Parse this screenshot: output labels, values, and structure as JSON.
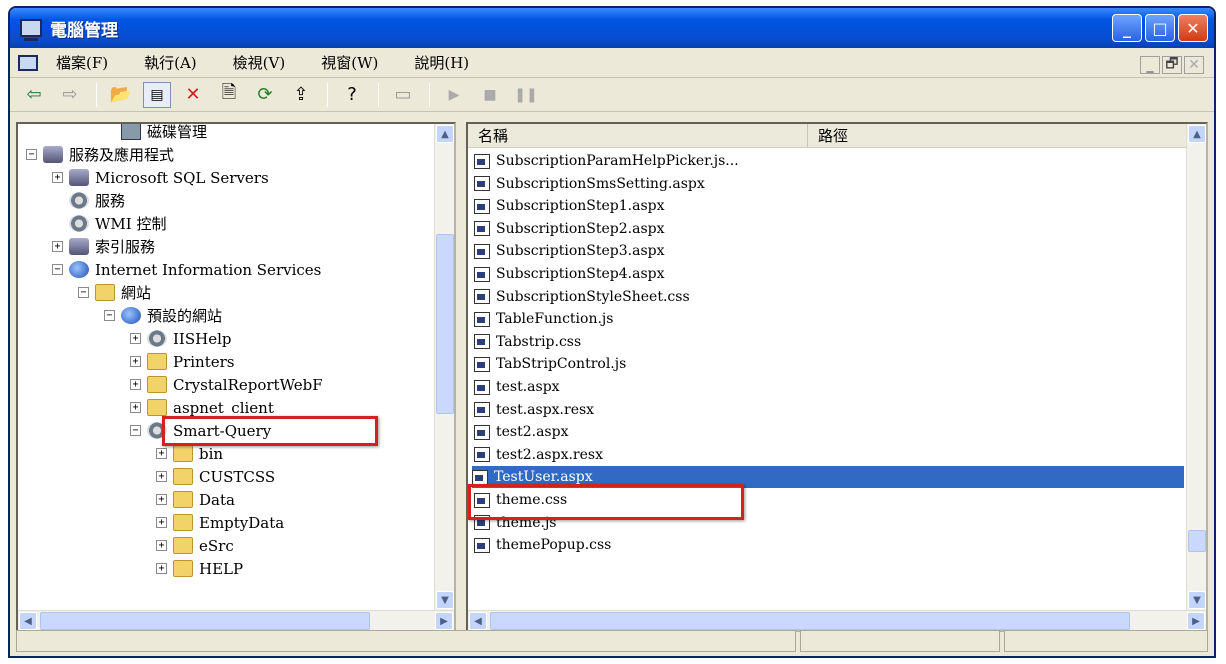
{
  "window": {
    "title": "電腦管理",
    "buttons": [
      "_",
      "□",
      "✕"
    ]
  },
  "menu": {
    "items": [
      "檔案(F)",
      "執行(A)",
      "檢視(V)",
      "視窗(W)",
      "說明(H)"
    ],
    "mdi": [
      "_",
      "🗗",
      "✕"
    ]
  },
  "toolbar": {
    "buttons": [
      "back-icon",
      "forward-icon",
      "up-folder-icon",
      "show-hide-tree-icon",
      "delete-icon",
      "properties-icon",
      "refresh-icon",
      "export-icon",
      "help-icon",
      "console-icon",
      "play-icon",
      "stop-icon",
      "pause-icon"
    ]
  },
  "tree": [
    {
      "label": "磁碟管理",
      "icon": "disk-icon",
      "indent": 3,
      "exp": ""
    },
    {
      "label": "服務及應用程式",
      "icon": "services-icon",
      "indent": 0,
      "exp": "−"
    },
    {
      "label": "Microsoft SQL Servers",
      "icon": "server-icon",
      "indent": 1,
      "exp": "+"
    },
    {
      "label": "服務",
      "icon": "gear-icon",
      "indent": 1,
      "exp": ""
    },
    {
      "label": "WMI 控制",
      "icon": "wmi-icon",
      "indent": 1,
      "exp": ""
    },
    {
      "label": "索引服務",
      "icon": "index-icon",
      "indent": 1,
      "exp": "+"
    },
    {
      "label": "Internet Information Services",
      "icon": "iis-icon",
      "indent": 1,
      "exp": "−"
    },
    {
      "label": "網站",
      "icon": "folder-icon",
      "indent": 2,
      "exp": "−"
    },
    {
      "label": "預設的網站",
      "icon": "globe-icon",
      "indent": 3,
      "exp": "−"
    },
    {
      "label": "IISHelp",
      "icon": "gear-icon",
      "indent": 4,
      "exp": "+"
    },
    {
      "label": "Printers",
      "icon": "folder-icon",
      "indent": 4,
      "exp": "+"
    },
    {
      "label": "CrystalReportWebF",
      "icon": "folder-icon",
      "indent": 4,
      "exp": "+"
    },
    {
      "label": "aspnet_client",
      "icon": "folder-icon",
      "indent": 4,
      "exp": "+"
    },
    {
      "label": "Smart-Query",
      "icon": "gear-icon",
      "indent": 4,
      "exp": "−"
    },
    {
      "label": "bin",
      "icon": "folder-icon",
      "indent": 5,
      "exp": "+"
    },
    {
      "label": "CUSTCSS",
      "icon": "folder-icon",
      "indent": 5,
      "exp": "+"
    },
    {
      "label": "Data",
      "icon": "folder-icon",
      "indent": 5,
      "exp": "+"
    },
    {
      "label": "EmptyData",
      "icon": "folder-icon",
      "indent": 5,
      "exp": "+"
    },
    {
      "label": "eSrc",
      "icon": "folder-icon",
      "indent": 5,
      "exp": "+"
    },
    {
      "label": "HELP",
      "icon": "folder-icon",
      "indent": 5,
      "exp": "+"
    }
  ],
  "list": {
    "columns": [
      "名稱",
      "路徑"
    ],
    "files": [
      "SubscriptionParamHelpPicker.js...",
      "SubscriptionSmsSetting.aspx",
      "SubscriptionStep1.aspx",
      "SubscriptionStep2.aspx",
      "SubscriptionStep3.aspx",
      "SubscriptionStep4.aspx",
      "SubscriptionStyleSheet.css",
      "TableFunction.js",
      "Tabstrip.css",
      "TabStripControl.js",
      "test.aspx",
      "test.aspx.resx",
      "test2.aspx",
      "test2.aspx.resx",
      "TestUser.aspx",
      "theme.css",
      "theme.js",
      "themePopup.css"
    ],
    "selected": "TestUser.aspx"
  },
  "colors": {
    "titlebar": "#0054e3",
    "selection": "#316ac5",
    "highlight": "#d42020"
  }
}
